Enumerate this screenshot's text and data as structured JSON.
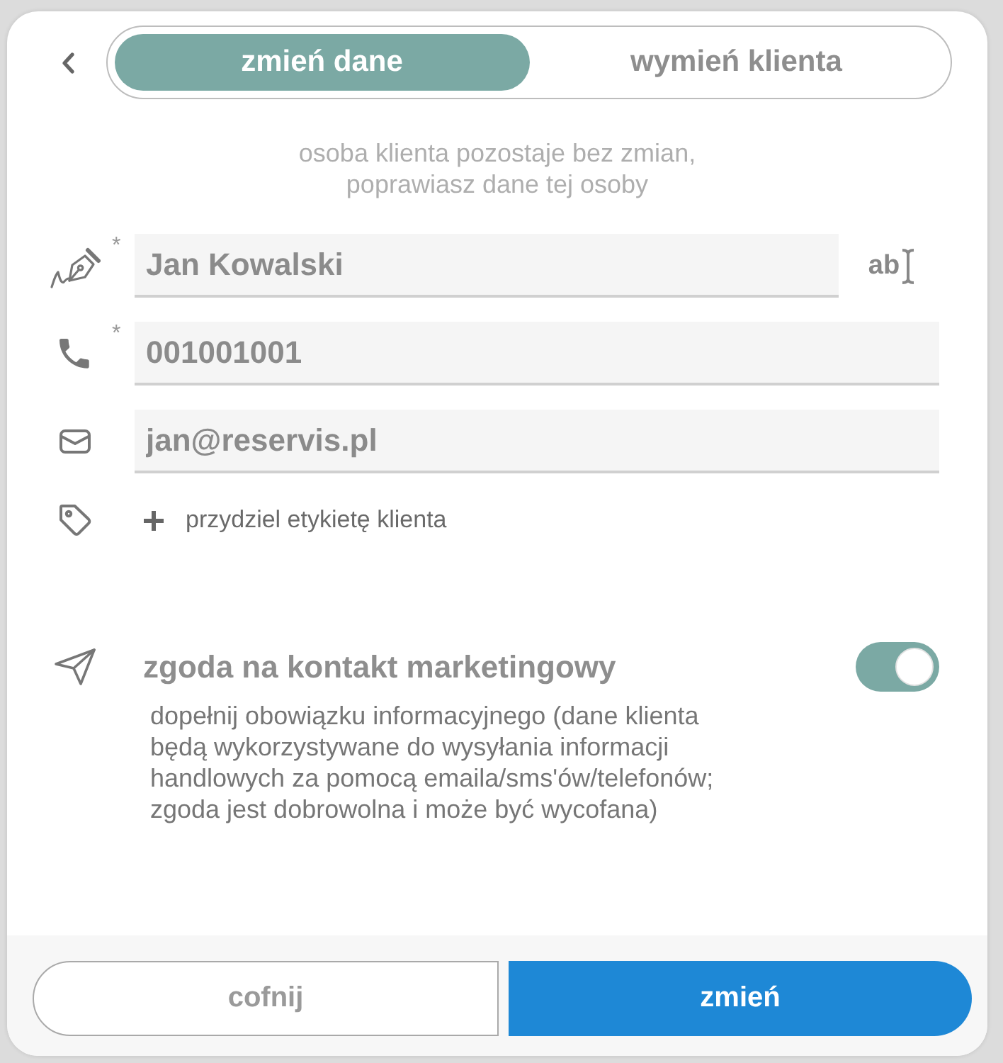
{
  "tabs": [
    {
      "label": "zmień dane",
      "selected": true
    },
    {
      "label": "wymień klienta",
      "selected": false
    }
  ],
  "hint": "osoba klienta pozostaje bez zmian,\npoprawiasz dane tej osoby",
  "fields": [
    {
      "kind": "name",
      "marker": "*",
      "value": "Jan Kowalski",
      "action": "ab"
    },
    {
      "kind": "phone",
      "marker": "*",
      "value": "001001001"
    },
    {
      "kind": "email",
      "value": "jan@reservis.pl"
    }
  ],
  "tag_link": "przydziel etykietę klienta",
  "marketing": {
    "title": "zgoda na kontakt marketingowy",
    "on": true,
    "description": "dopełnij obowiązku informacyjnego (dane klienta\nbędą wykorzystywane do wysyłania informacji\nhandlowych za pomocą emaila/sms'ów/telefonów;\nzgoda jest dobrowolna i może być wycofana)"
  },
  "buttons": [
    {
      "kind": "secondary",
      "label": "cofnij"
    },
    {
      "kind": "primary",
      "label": "zmień"
    }
  ]
}
